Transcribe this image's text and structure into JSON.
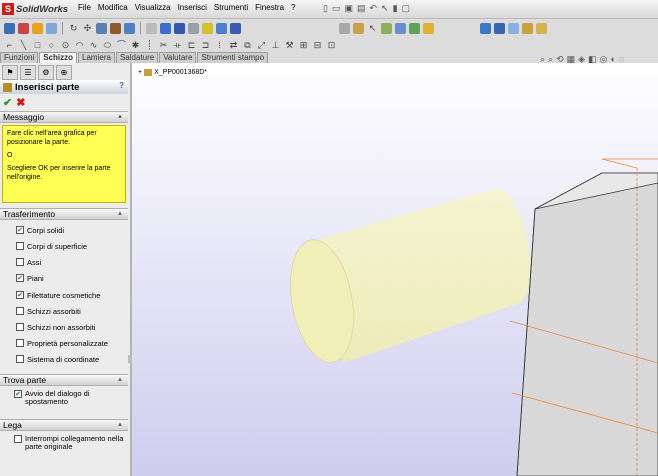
{
  "app": {
    "name": "SolidWorks",
    "logo_mark": "S"
  },
  "menu": [
    "File",
    "Modifica",
    "Visualizza",
    "Inserisci",
    "Strumenti",
    "Finestra",
    "?"
  ],
  "tabs": [
    {
      "label": "Funzioni",
      "active": false
    },
    {
      "label": "Schizzo",
      "active": true
    },
    {
      "label": "Lamiera",
      "active": false
    },
    {
      "label": "Saldature",
      "active": false
    },
    {
      "label": "Valutare",
      "active": false
    },
    {
      "label": "Strumenti stampo",
      "active": false
    }
  ],
  "property_manager": {
    "title": "Inserisci parte",
    "help": "?",
    "ok": "✔",
    "cancel": "✖",
    "sections": {
      "messaggio": {
        "title": "Messaggio",
        "lines": [
          "Fare clic nell'area grafica per posizionare la parte.",
          "O",
          "Scegliere OK per inserire la parte nell'origine."
        ]
      },
      "trasferimento": {
        "title": "Trasferimento",
        "items": [
          {
            "label": "Corpi solidi",
            "checked": true
          },
          {
            "label": "Corpi di superficie",
            "checked": false
          },
          {
            "label": "Assi",
            "checked": false
          },
          {
            "label": "Piani",
            "checked": true
          },
          {
            "label": "Filettature cosmetiche",
            "checked": true
          },
          {
            "label": "Schizzi assorbiti",
            "checked": false
          },
          {
            "label": "Schizzi non assorbiti",
            "checked": false
          },
          {
            "label": "Proprietà personalizzate",
            "checked": false
          },
          {
            "label": "Sistema di coordinate",
            "checked": false
          }
        ]
      },
      "trova_parte": {
        "title": "Trova parte",
        "items": [
          {
            "label": "Avvio del dialogo di spostamento",
            "checked": true
          }
        ]
      },
      "lega": {
        "title": "Lega",
        "items": [
          {
            "label": "Interrompi collegamento nella parte originale",
            "checked": false
          }
        ]
      }
    }
  },
  "feature_tree": {
    "item": "X_PP0001368D*"
  },
  "colors": {
    "accent_red": "#cc1d1d",
    "message_bg": "#ffff55",
    "cylinder": "#f4f2c4",
    "box_face": "#dcdcdc",
    "edge_orange": "#e8883a"
  }
}
